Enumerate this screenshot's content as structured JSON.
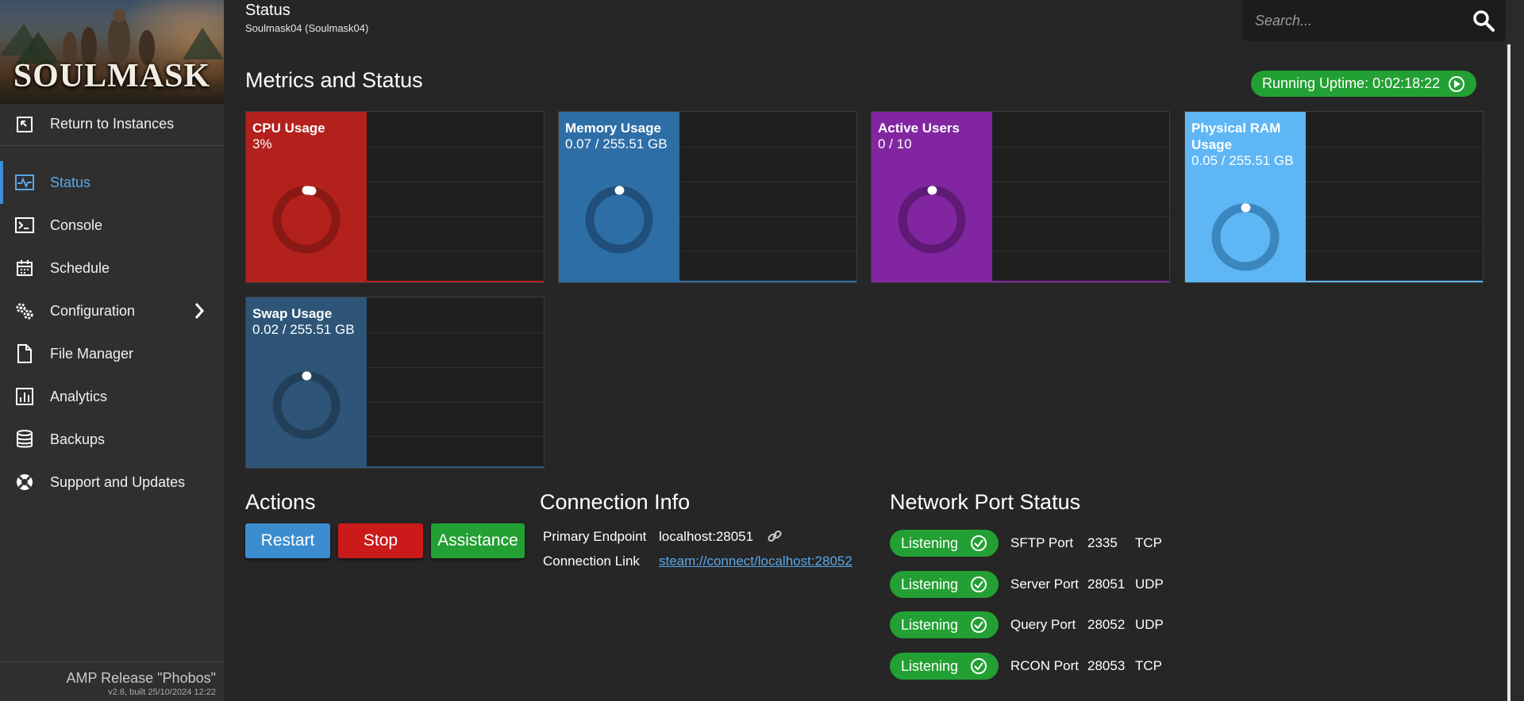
{
  "sidebar": {
    "logo_text": "SOULMASK",
    "return_label": "Return to Instances",
    "items": [
      {
        "label": "Status",
        "icon": "pulse-icon",
        "active": true
      },
      {
        "label": "Console",
        "icon": "terminal-icon"
      },
      {
        "label": "Schedule",
        "icon": "calendar-icon"
      },
      {
        "label": "Configuration",
        "icon": "cogs-icon"
      },
      {
        "label": "File Manager",
        "icon": "file-icon"
      },
      {
        "label": "Analytics",
        "icon": "bar-chart-icon"
      },
      {
        "label": "Backups",
        "icon": "database-icon"
      },
      {
        "label": "Support and Updates",
        "icon": "lifebuoy-icon"
      }
    ],
    "version_title": "AMP Release \"Phobos\"",
    "version_build": "v2.6, built 25/10/2024 12:22"
  },
  "header": {
    "title": "Status",
    "subtitle": "Soulmask04 (Soulmask04)",
    "search_placeholder": "Search..."
  },
  "metrics": {
    "title": "Metrics and Status",
    "uptime": "Running Uptime: 0:02:18:22",
    "cards": [
      {
        "label": "CPU Usage",
        "value": "3%",
        "color": "#b3211c",
        "ring": "#8a1814",
        "fraction": 0.03
      },
      {
        "label": "Memory Usage",
        "value": "0.07 / 255.51 GB",
        "color": "#2e6ea6",
        "ring": "#1f4f7a",
        "fraction": 0.0003
      },
      {
        "label": "Active Users",
        "value": "0 / 10",
        "color": "#8126a0",
        "ring": "#5e1a76",
        "fraction": 0
      },
      {
        "label": "Physical RAM Usage",
        "value": "0.05 / 255.51 GB",
        "color": "#5eb6f5",
        "ring": "#3a86be",
        "fraction": 0.0002
      },
      {
        "label": "Swap Usage",
        "value": "0.02 / 255.51 GB",
        "color": "#2e5577",
        "ring": "#213f59",
        "fraction": 0.0001
      }
    ]
  },
  "actions": {
    "title": "Actions",
    "restart": "Restart",
    "stop": "Stop",
    "assistance": "Assistance"
  },
  "connection": {
    "title": "Connection Info",
    "primary_label": "Primary Endpoint",
    "primary_value": "localhost:28051",
    "link_label": "Connection Link",
    "link_value": "steam://connect/localhost:28052"
  },
  "ports": {
    "title": "Network Port Status",
    "rows": [
      {
        "status": "Listening",
        "name": "SFTP Port",
        "port": "2335",
        "protocol": "TCP"
      },
      {
        "status": "Listening",
        "name": "Server Port",
        "port": "28051",
        "protocol": "UDP"
      },
      {
        "status": "Listening",
        "name": "Query Port",
        "port": "28052",
        "protocol": "UDP"
      },
      {
        "status": "Listening",
        "name": "RCON Port",
        "port": "28053",
        "protocol": "TCP"
      }
    ]
  },
  "colors": {
    "accent_blue": "#3c8dcf",
    "success_green": "#23a033",
    "danger_red": "#cb1a1a"
  }
}
